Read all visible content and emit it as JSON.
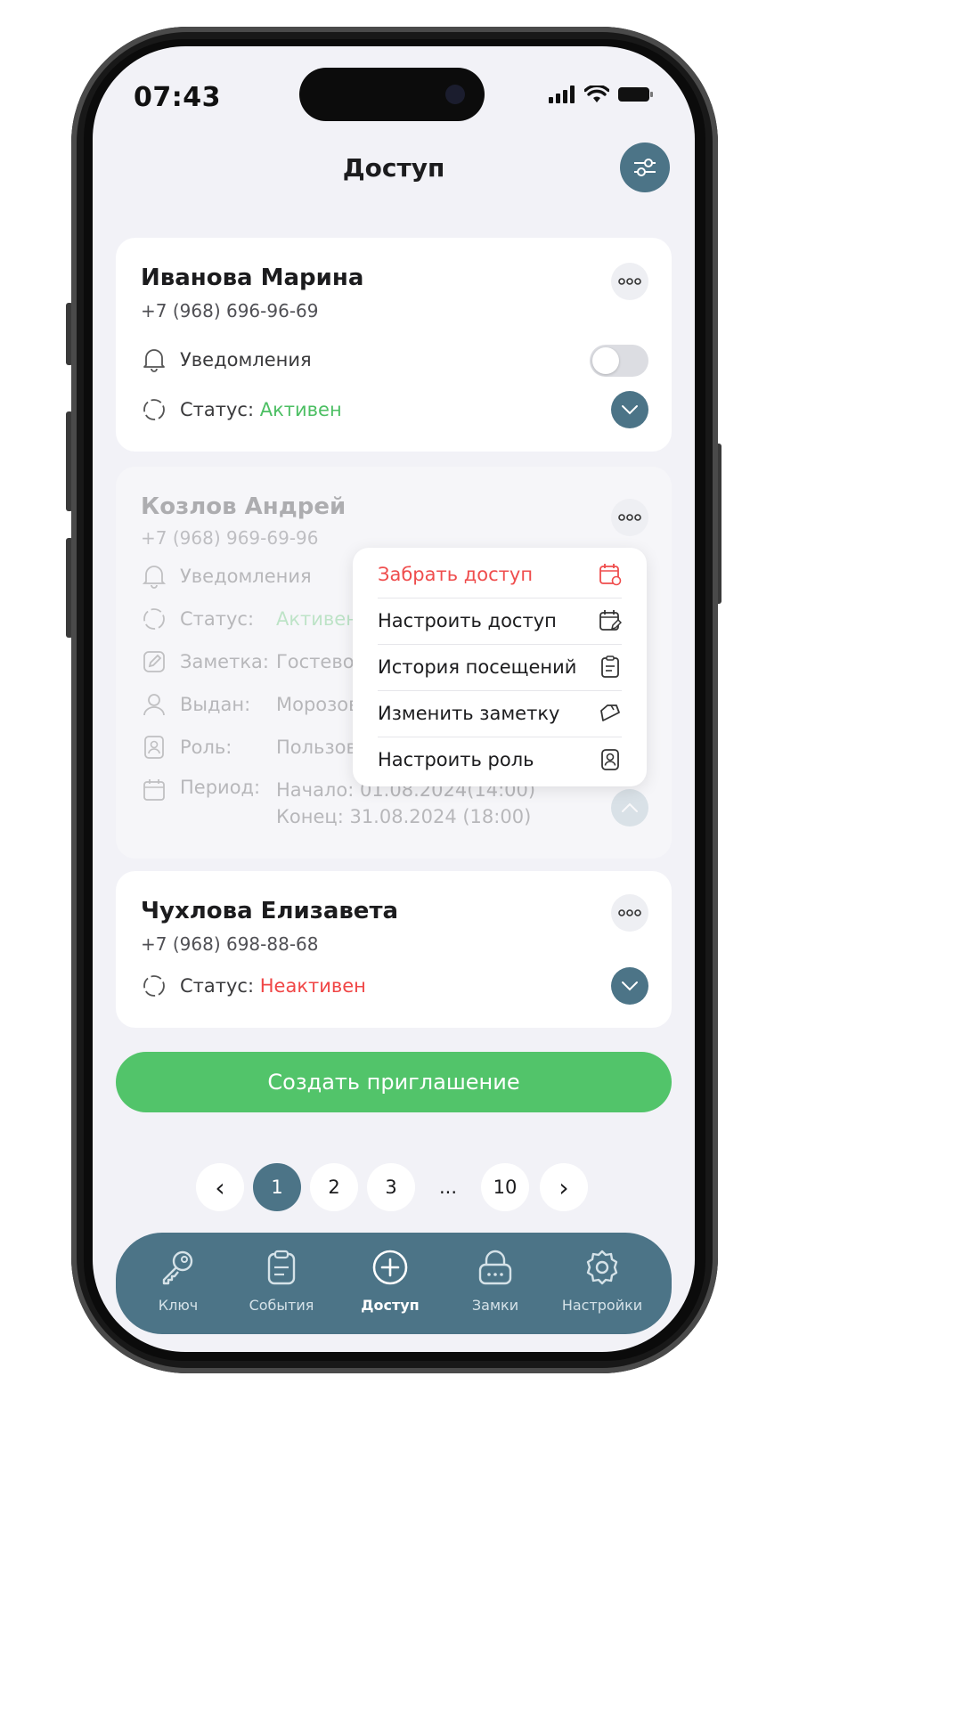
{
  "status_bar": {
    "time": "07:43"
  },
  "header": {
    "title": "Доступ"
  },
  "cards": [
    {
      "name": "Иванова Марина",
      "phone": "+7 (968) 696-96-69",
      "notifications_label": "Уведомления",
      "notifications_on": false,
      "status_label": "Статус:",
      "status_value": "Активен",
      "status_color": "#4cbf63"
    },
    {
      "name": "Козлов Андрей",
      "phone": "+7 (968) 969-69-96",
      "notifications_label": "Уведомления",
      "status_label": "Статус:",
      "status_value": "Активен",
      "note_label": "Заметка:",
      "note_value": "Гостевой",
      "issued_label": "Выдан:",
      "issued_value": "Морозов",
      "role_label": "Роль:",
      "role_value": "Пользователь",
      "period_label": "Период:",
      "period_start": "Начало: 01.08.2024(14:00)",
      "period_end": "Конец: 31.08.2024 (18:00)"
    },
    {
      "name": "Чухлова Елизавета",
      "phone": "+7 (968) 698-88-68",
      "status_label": "Статус:",
      "status_value": "Неактивен",
      "status_color": "#f04646"
    }
  ],
  "context_menu": [
    {
      "label": "Забрать доступ",
      "icon": "calendar-remove-icon",
      "danger": true
    },
    {
      "label": "Настроить доступ",
      "icon": "calendar-edit-icon"
    },
    {
      "label": "История посещений",
      "icon": "clipboard-icon"
    },
    {
      "label": "Изменить заметку",
      "icon": "note-edit-icon"
    },
    {
      "label": "Настроить роль",
      "icon": "user-badge-icon"
    }
  ],
  "cta": {
    "label": "Создать приглашение"
  },
  "pagination": {
    "prev": "‹",
    "pages": [
      "1",
      "2",
      "3"
    ],
    "ellipsis": "...",
    "last": "10",
    "next": "›",
    "current": "1"
  },
  "tabbar": [
    {
      "label": "Ключ",
      "icon": "key-icon"
    },
    {
      "label": "События",
      "icon": "clipboard-icon"
    },
    {
      "label": "Доступ",
      "icon": "plus-circle-icon",
      "active": true
    },
    {
      "label": "Замки",
      "icon": "lock-icon"
    },
    {
      "label": "Настройки",
      "icon": "gear-icon"
    }
  ]
}
